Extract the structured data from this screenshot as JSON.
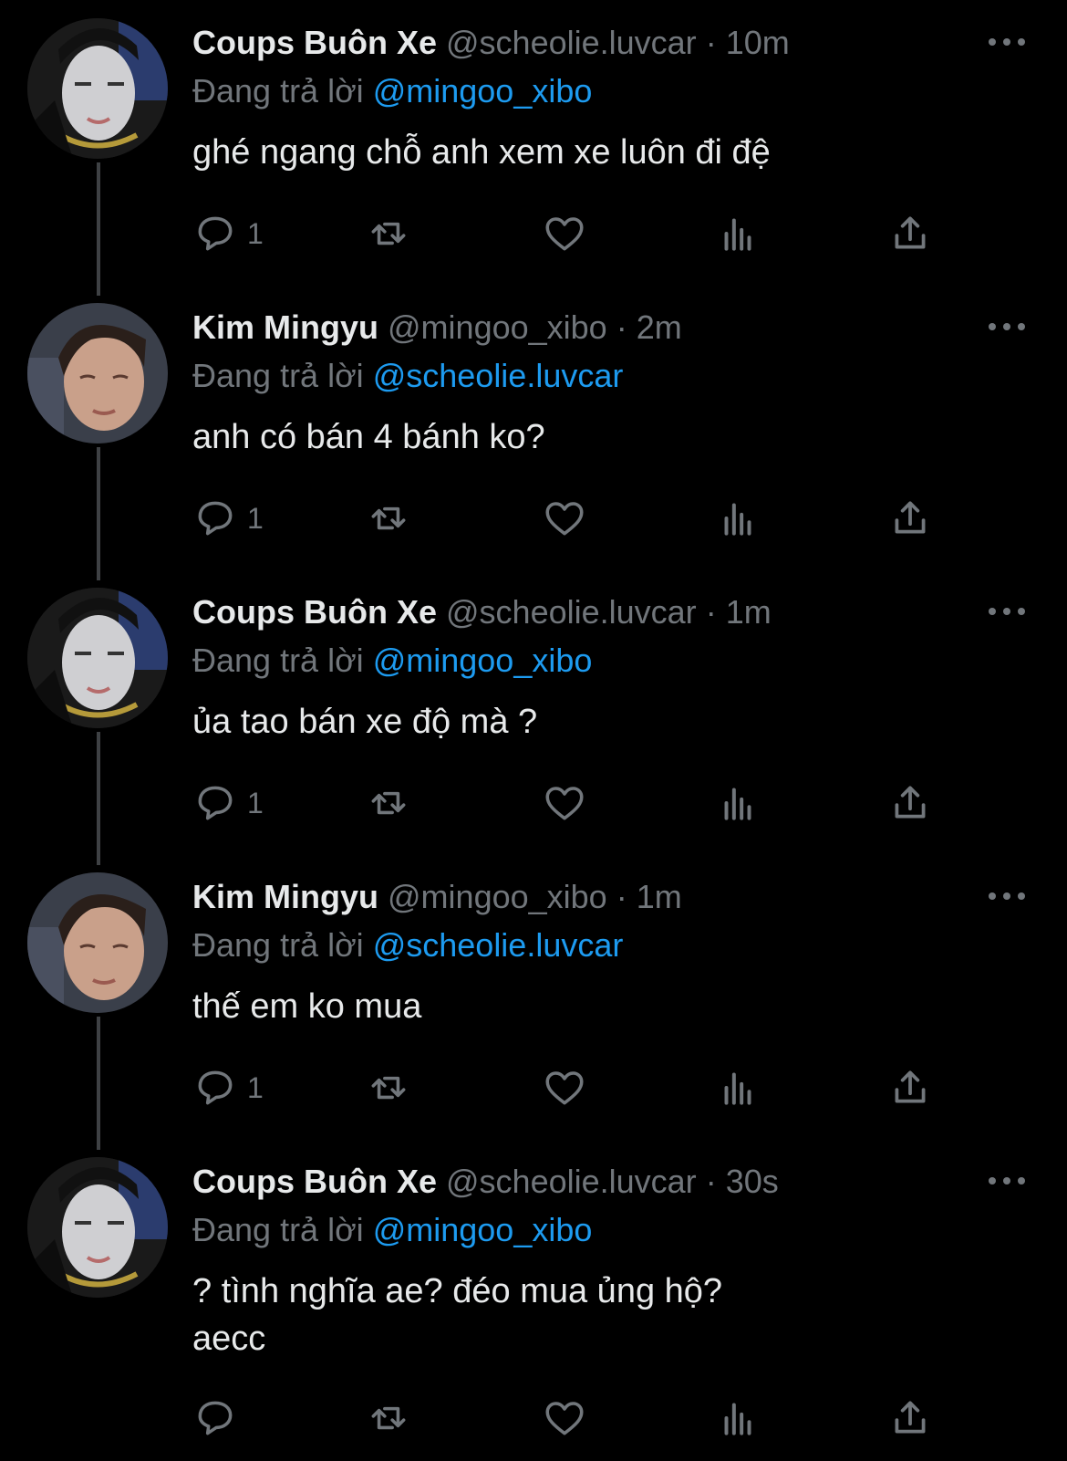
{
  "colors": {
    "background": "#000000",
    "text": "#e7e9ea",
    "muted": "#71767b",
    "link": "#1d9bf0",
    "thread_line": "#3e4144"
  },
  "icons": {
    "reply": "speech-bubble-icon",
    "retweet": "retweet-icon",
    "like": "heart-icon",
    "views": "bar-chart-icon",
    "share": "share-upload-icon",
    "more": "ellipsis-icon"
  },
  "reply_label": "Đang trả lời",
  "tweets": [
    {
      "name": "Coups Buôn Xe",
      "handle": "@scheolie.luvcar",
      "separator": "·",
      "time": "10m",
      "reply_to": "@mingoo_xibo",
      "text": "ghé ngang chỗ anh xem xe luôn đi đệ",
      "reply_count": "1"
    },
    {
      "name": "Kim Mingyu",
      "handle": "@mingoo_xibo",
      "separator": "·",
      "time": "2m",
      "reply_to": "@scheolie.luvcar",
      "text": "anh có bán 4 bánh ko?",
      "reply_count": "1"
    },
    {
      "name": "Coups Buôn Xe",
      "handle": "@scheolie.luvcar",
      "separator": "·",
      "time": "1m",
      "reply_to": "@mingoo_xibo",
      "text": "ủa tao bán xe độ mà ?",
      "reply_count": "1"
    },
    {
      "name": "Kim Mingyu",
      "handle": "@mingoo_xibo",
      "separator": "·",
      "time": "1m",
      "reply_to": "@scheolie.luvcar",
      "text": "thế em ko mua",
      "reply_count": "1"
    },
    {
      "name": "Coups Buôn Xe",
      "handle": "@scheolie.luvcar",
      "separator": "·",
      "time": "30s",
      "reply_to": "@mingoo_xibo",
      "text": "? tình nghĩa ae? đéo mua ủng hộ?\naecc",
      "reply_count": ""
    }
  ]
}
